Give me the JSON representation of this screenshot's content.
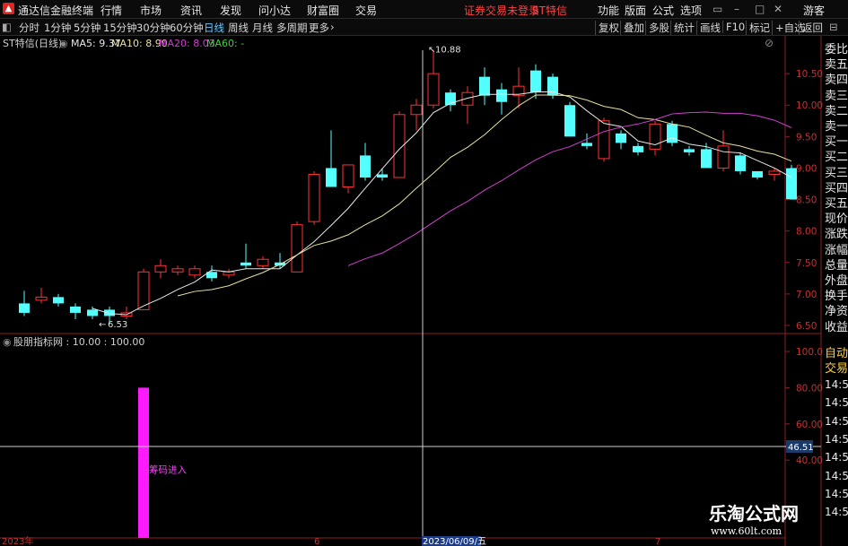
{
  "titlebar": {
    "app_name": "通达信金融终端",
    "menu": [
      "行情",
      "市场",
      "资讯",
      "发现",
      "问小达",
      "财富圈",
      "交易"
    ],
    "login_status": "证券交易未登录",
    "stock_name": "ST特信",
    "right_menu": [
      "功能",
      "版面",
      "公式",
      "选项"
    ],
    "guest": "游客",
    "colors": {
      "login_status": "#ff4040",
      "stock_name": "#ff4040"
    }
  },
  "toolbar": {
    "periods": [
      "分时",
      "1分钟",
      "5分钟",
      "15分钟",
      "30分钟",
      "60分钟",
      "日线",
      "周线",
      "月线",
      "多周期",
      "更多"
    ],
    "active_period": "日线",
    "more_arrow": "›",
    "right_buttons": [
      "复权",
      "叠加",
      "多股",
      "统计",
      "画线",
      "F10",
      "标记",
      "+自选",
      "返回"
    ]
  },
  "chart": {
    "label": "ST特信(日线)",
    "ma": [
      {
        "label": "MA5: 9.37",
        "color": "#e8e8e8"
      },
      {
        "label": "MA10: 8.90",
        "color": "#e8e0a0"
      },
      {
        "label": "MA20: 8.03",
        "color": "#d040d0"
      },
      {
        "label": "MA60: -",
        "color": "#40d040"
      }
    ],
    "high_label": "10.88",
    "low_label": "6.53",
    "price_ticks": [
      "10.50",
      "10.00",
      "9.50",
      "9.00",
      "8.50",
      "8.00",
      "7.50",
      "7.00",
      "6.50"
    ]
  },
  "indicator": {
    "label": "股朋指标网 : 10.00 : 100.00",
    "annotation": "筹码进入",
    "ticks": [
      "100.0",
      "80.00",
      "60.00",
      "40.00"
    ],
    "crosshair_value": "46.51"
  },
  "xaxis": {
    "year": "2023年",
    "month_6": "6",
    "month_7": "7",
    "cursor_date": "2023/06/09/五"
  },
  "side_panel": {
    "upper": [
      "委比",
      "卖五",
      "卖四",
      "卖三",
      "卖二",
      "卖一",
      "买一",
      "买二",
      "买三",
      "买四",
      "买五",
      "现价",
      "涨跌",
      "涨幅",
      "总量",
      "外盘",
      "换手",
      "净资",
      "收益"
    ],
    "auto_label": "自动",
    "trade_label": "交易",
    "times": [
      "14:56",
      "14:56",
      "14:56",
      "14:56",
      "14:56",
      "14:56",
      "14:56",
      "14:56"
    ]
  },
  "watermark": {
    "title": "乐淘公式网",
    "url": "www.60lt.com"
  },
  "chart_data": {
    "type": "candlestick",
    "candles": [
      [
        6.85,
        6.7,
        7.05,
        6.65
      ],
      [
        6.9,
        6.95,
        7.1,
        6.85
      ],
      [
        6.95,
        6.85,
        7.0,
        6.8
      ],
      [
        6.8,
        6.7,
        6.85,
        6.6
      ],
      [
        6.75,
        6.65,
        6.8,
        6.6
      ],
      [
        6.75,
        6.65,
        6.8,
        6.53
      ],
      [
        6.65,
        6.7,
        6.8,
        6.6
      ],
      [
        6.75,
        7.35,
        7.4,
        6.75
      ],
      [
        7.35,
        7.45,
        7.55,
        7.25
      ],
      [
        7.35,
        7.4,
        7.45,
        7.3
      ],
      [
        7.3,
        7.4,
        7.45,
        7.25
      ],
      [
        7.35,
        7.25,
        7.45,
        7.2
      ],
      [
        7.3,
        7.35,
        7.4,
        7.25
      ],
      [
        7.5,
        7.45,
        7.8,
        7.4
      ],
      [
        7.45,
        7.55,
        7.6,
        7.4
      ],
      [
        7.5,
        7.45,
        7.65,
        7.4
      ],
      [
        7.35,
        8.1,
        8.15,
        7.35
      ],
      [
        8.15,
        8.9,
        8.95,
        8.1
      ],
      [
        9.0,
        8.7,
        9.6,
        8.7
      ],
      [
        8.7,
        9.05,
        9.05,
        8.6
      ],
      [
        9.2,
        8.85,
        9.4,
        8.8
      ],
      [
        8.9,
        8.85,
        9.0,
        8.8
      ],
      [
        8.85,
        9.85,
        9.9,
        8.85
      ],
      [
        9.85,
        10.0,
        10.1,
        9.6
      ],
      [
        10.0,
        10.5,
        10.88,
        9.95
      ],
      [
        10.2,
        10.0,
        10.25,
        9.9
      ],
      [
        10.0,
        10.2,
        10.3,
        9.7
      ],
      [
        10.45,
        10.15,
        10.6,
        10.0
      ],
      [
        10.25,
        10.05,
        10.35,
        9.85
      ],
      [
        10.15,
        10.3,
        10.6,
        9.95
      ],
      [
        10.55,
        10.2,
        10.65,
        10.1
      ],
      [
        10.45,
        10.15,
        10.5,
        10.1
      ],
      [
        10.0,
        9.5,
        10.05,
        9.5
      ],
      [
        9.4,
        9.35,
        9.55,
        9.3
      ],
      [
        9.15,
        9.75,
        9.8,
        9.1
      ],
      [
        9.55,
        9.4,
        9.6,
        9.3
      ],
      [
        9.35,
        9.25,
        9.4,
        9.2
      ],
      [
        9.3,
        9.7,
        9.75,
        9.2
      ],
      [
        9.7,
        9.4,
        9.75,
        9.35
      ],
      [
        9.3,
        9.25,
        9.35,
        9.2
      ],
      [
        9.3,
        9.0,
        9.4,
        9.0
      ],
      [
        9.0,
        9.35,
        9.6,
        8.95
      ],
      [
        9.2,
        8.95,
        9.25,
        8.9
      ],
      [
        8.95,
        8.85,
        8.95,
        8.82
      ],
      [
        8.9,
        8.95,
        9.0,
        8.8
      ],
      [
        9.0,
        8.5,
        9.05,
        8.5
      ]
    ],
    "ma5": [
      null,
      null,
      null,
      null,
      6.77,
      6.69,
      6.67,
      6.81,
      6.93,
      7.07,
      7.19,
      7.38,
      7.35,
      7.4,
      7.4,
      7.4,
      7.62,
      7.83,
      8.09,
      8.36,
      8.68,
      8.99,
      9.3,
      9.56,
      9.88,
      10.03,
      10.11,
      10.17,
      10.17,
      10.17,
      10.21,
      10.21,
      10.13,
      9.91,
      9.71,
      9.66,
      9.43,
      9.37,
      9.48,
      9.38,
      9.34,
      9.26,
      9.24,
      9.12,
      9.0,
      8.85
    ],
    "ma10": [
      null,
      null,
      null,
      null,
      null,
      null,
      null,
      null,
      null,
      6.97,
      7.04,
      7.07,
      7.13,
      7.24,
      7.34,
      7.47,
      7.62,
      7.77,
      7.84,
      7.94,
      8.1,
      8.24,
      8.43,
      8.68,
      8.92,
      9.17,
      9.33,
      9.53,
      9.77,
      9.99,
      10.16,
      10.16,
      10.15,
      10.08,
      9.98,
      9.93,
      9.8,
      9.77,
      9.7,
      9.65,
      9.52,
      9.4,
      9.35,
      9.27,
      9.22,
      9.11
    ],
    "ma20": [
      null,
      null,
      null,
      null,
      null,
      null,
      null,
      null,
      null,
      null,
      null,
      null,
      null,
      null,
      null,
      null,
      null,
      null,
      null,
      7.45,
      7.56,
      7.65,
      7.8,
      7.96,
      8.14,
      8.32,
      8.47,
      8.65,
      8.8,
      8.97,
      9.13,
      9.26,
      9.34,
      9.46,
      9.58,
      9.65,
      9.7,
      9.77,
      9.86,
      9.88,
      9.89,
      9.87,
      9.87,
      9.83,
      9.76,
      9.64
    ],
    "indicator_bar": {
      "index": 7,
      "value": 80
    },
    "price_range": [
      6.4,
      11.1
    ],
    "indicator_range": [
      0,
      100
    ]
  }
}
